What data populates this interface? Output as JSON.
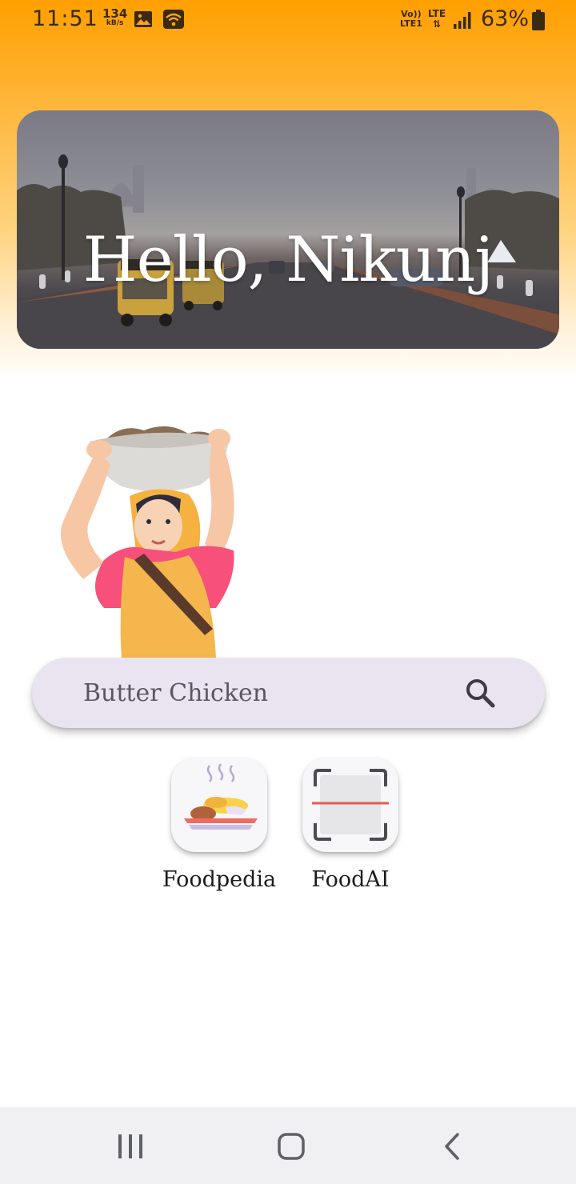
{
  "status_bar": {
    "time": "11:51",
    "net_speed_value": "134",
    "net_speed_unit": "kB/s",
    "volte_line1": "Vo))",
    "volte_line2": "LTE1",
    "lte_label": "LTE",
    "battery_percent": "63%",
    "icons": [
      "image-icon",
      "wifi-icon",
      "signal-icon",
      "battery-icon"
    ]
  },
  "banner": {
    "greeting": "Hello, Nikunj"
  },
  "search": {
    "placeholder": "Butter Chicken",
    "icon": "search-icon"
  },
  "tiles": [
    {
      "label": "Foodpedia",
      "icon": "food-plate-icon"
    },
    {
      "label": "FoodAI",
      "icon": "scan-frame-icon"
    }
  ],
  "nav": {
    "buttons": [
      "recents-icon",
      "home-icon",
      "back-icon"
    ]
  },
  "colors": {
    "header_gradient_top": "#ff9f00",
    "search_bg": "#e9e4ef",
    "nav_bg": "#f0eff1"
  }
}
